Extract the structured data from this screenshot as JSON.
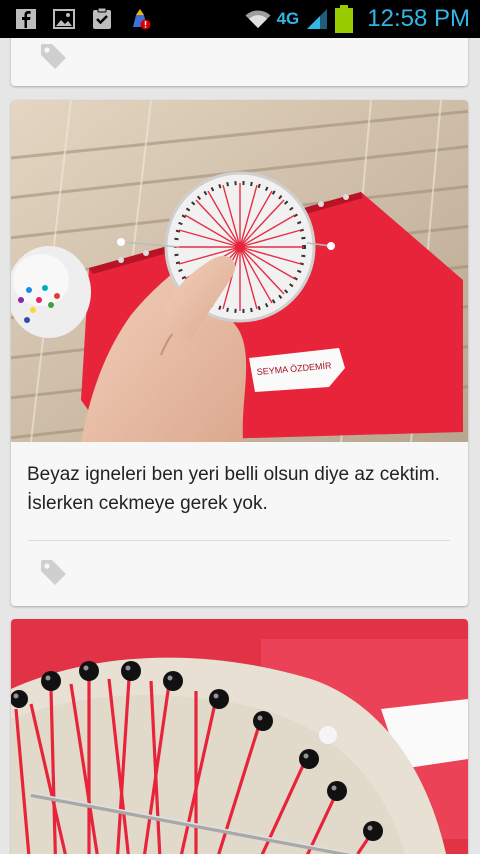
{
  "status_bar": {
    "network": "4G",
    "time": "12:58 PM",
    "icons": [
      "facebook-icon",
      "gallery-icon",
      "clipboard-check-icon",
      "app-update-icon",
      "wifi-icon",
      "signal-icon",
      "battery-icon"
    ]
  },
  "feed": {
    "posts": [
      {
        "tag_icon": "tag-icon"
      },
      {
        "caption": "Beyaz igneleri ben yeri belli olsun diye az cektim. İslerken cekmeye gerek yok.",
        "photo_label": "SEYMA ÖZDEMİR",
        "tag_icon": "tag-icon"
      },
      {
        "photo": "embroidery-closeup"
      }
    ]
  },
  "colors": {
    "status_accent": "#33b5e5",
    "thread_red": "#e8243b",
    "card_bg": "#f7f7f7",
    "feed_bg": "#e6e6e6"
  }
}
